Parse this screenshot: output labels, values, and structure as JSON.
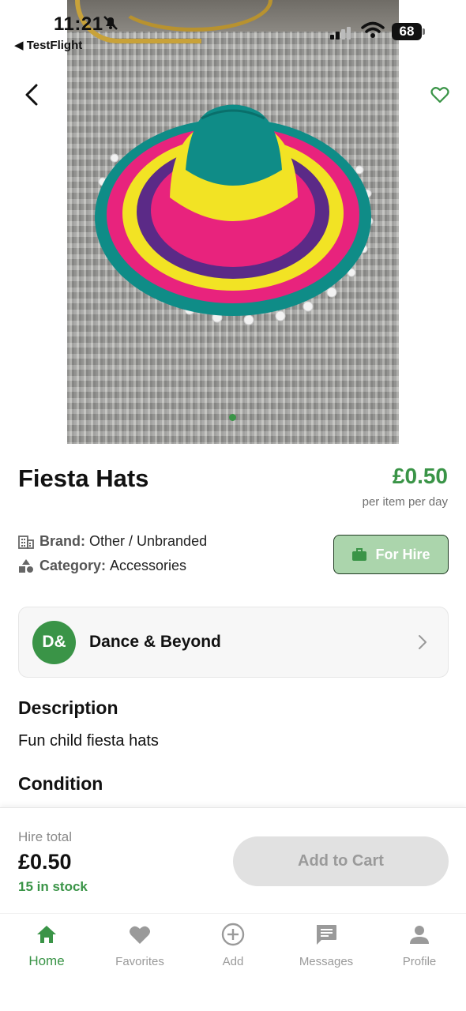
{
  "status_bar": {
    "time": "11:21",
    "back_app": "◀ TestFlight",
    "battery": "68"
  },
  "product": {
    "title": "Fiesta Hats",
    "price": "£0.50",
    "price_unit": "per item per day",
    "brand_key": "Brand:",
    "brand_value": "Other / Unbranded",
    "category_key": "Category:",
    "category_value": "Accessories",
    "listing_type": "For Hire",
    "image_count_dots": 1
  },
  "seller": {
    "initials": "D&",
    "name": "Dance & Beyond"
  },
  "sections": {
    "description_heading": "Description",
    "description_text": "Fun child fiesta hats",
    "condition_heading": "Condition"
  },
  "purchase": {
    "hire_label": "Hire total",
    "hire_total": "£0.50",
    "stock": "15 in stock",
    "add_to_cart": "Add to Cart"
  },
  "tabs": [
    {
      "label": "Home",
      "icon": "home-icon",
      "active": true
    },
    {
      "label": "Favorites",
      "icon": "heart-icon",
      "active": false
    },
    {
      "label": "Add",
      "icon": "plus-circle-icon",
      "active": false
    },
    {
      "label": "Messages",
      "icon": "message-icon",
      "active": false
    },
    {
      "label": "Profile",
      "icon": "person-icon",
      "active": false
    }
  ],
  "colors": {
    "accent": "#3a9447",
    "badge_bg": "#abd5ac",
    "disabled_button": "#e1e1e1"
  }
}
